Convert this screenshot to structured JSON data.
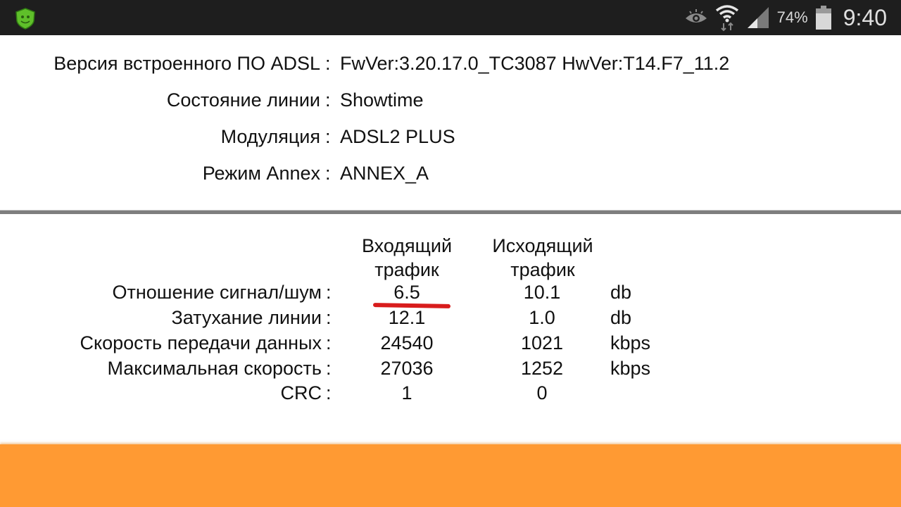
{
  "status_bar": {
    "app_icon": "dr-web-shield-icon",
    "icons": [
      "eye-icon",
      "wifi-icon",
      "signal-icon",
      "battery-icon"
    ],
    "battery_percent": "74%",
    "time": "9:40"
  },
  "info": [
    {
      "label": "Версия встроенного ПО ADSL",
      "colon": ":",
      "value": "FwVer:3.20.17.0_TC3087 HwVer:T14.F7_11.2"
    },
    {
      "label": "Состояние линии",
      "colon": ":",
      "value": "Showtime"
    },
    {
      "label": "Модуляция",
      "colon": ":",
      "value": "ADSL2 PLUS"
    },
    {
      "label": "Режим Annex",
      "colon": ":",
      "value": "ANNEX_A"
    }
  ],
  "stats": {
    "headers": {
      "downstream": [
        "Входящий",
        "трафик"
      ],
      "upstream": [
        "Исходящий",
        "трафик"
      ]
    },
    "rows": [
      {
        "label": "Отношение сигнал/шум",
        "colon": ":",
        "down": "6.5",
        "up": "10.1",
        "unit": "db",
        "highlighted": true
      },
      {
        "label": "Затухание линии",
        "colon": ":",
        "down": "12.1",
        "up": "1.0",
        "unit": "db"
      },
      {
        "label": "Скорость передачи данных",
        "colon": ":",
        "down": "24540",
        "up": "1021",
        "unit": "kbps"
      },
      {
        "label": "Максимальная скорость",
        "colon": ":",
        "down": "27036",
        "up": "1252",
        "unit": "kbps"
      },
      {
        "label": "CRC",
        "colon": ":",
        "down": "1",
        "up": "0",
        "unit": ""
      }
    ]
  },
  "colors": {
    "status_bar_bg": "#1e1e1e",
    "highlight_stroke": "#d81c1c",
    "bottom_bar": "#ff9a33",
    "divider": "#7e7e7e"
  }
}
